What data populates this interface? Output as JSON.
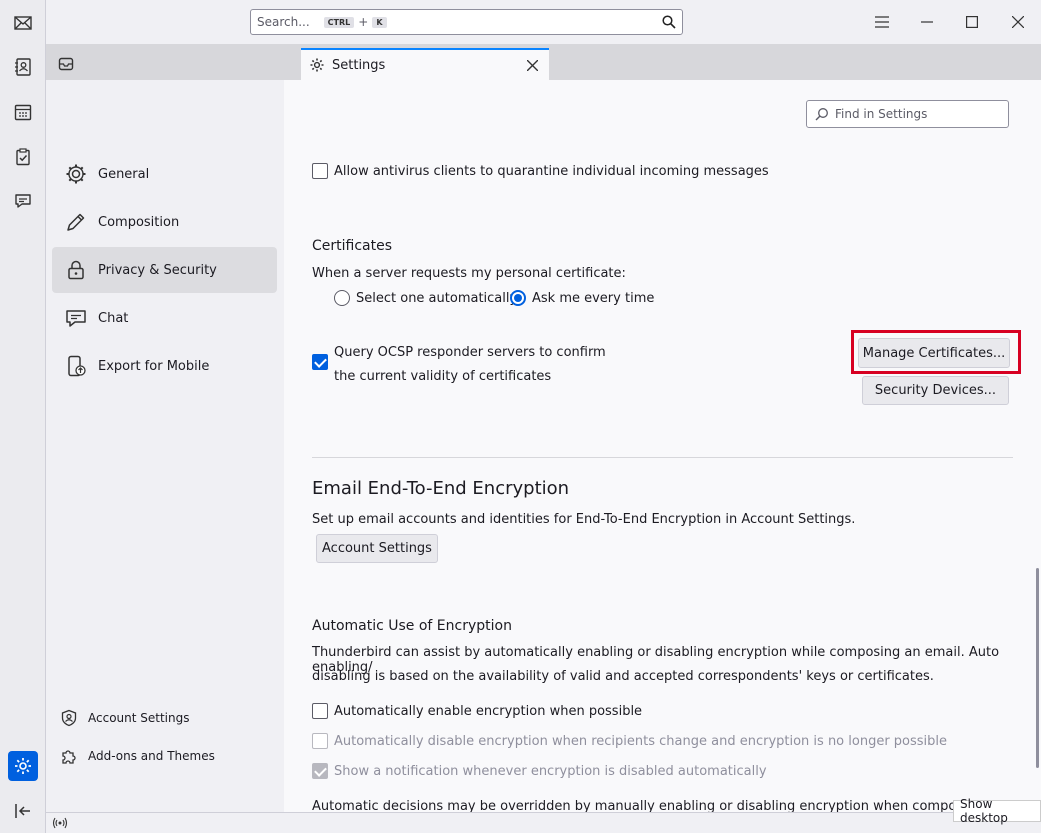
{
  "titlebar": {
    "search_placeholder": "Search...",
    "kbd_ctrl": "CTRL",
    "kbd_plus": "+",
    "kbd_k": "K"
  },
  "tab": {
    "label": "Settings"
  },
  "nav": {
    "items": [
      {
        "label": "General"
      },
      {
        "label": "Composition"
      },
      {
        "label": "Privacy & Security"
      },
      {
        "label": "Chat"
      },
      {
        "label": "Export for Mobile"
      }
    ],
    "footer": [
      {
        "label": "Account Settings"
      },
      {
        "label": "Add-ons and Themes"
      }
    ]
  },
  "content": {
    "find_placeholder": "Find in Settings",
    "antivirus_label": "Allow antivirus clients to quarantine individual incoming messages",
    "certificates": {
      "heading": "Certificates",
      "prompt": "When a server requests my personal certificate:",
      "option_auto": "Select one automatically",
      "option_ask": "Ask me every time",
      "ocsp_line1": "Query OCSP responder servers to confirm",
      "ocsp_line2": "the current validity of certificates",
      "manage_button": "Manage Certificates...",
      "devices_button": "Security Devices..."
    },
    "e2e": {
      "heading": "Email End-To-End Encryption",
      "description": "Set up email accounts and identities for End-To-End Encryption in Account Settings.",
      "button": "Account Settings"
    },
    "auto": {
      "heading": "Automatic Use of Encryption",
      "desc_line1": "Thunderbird can assist by automatically enabling or disabling encryption while composing an email. Auto enabling/",
      "desc_line2": "disabling is based on the availability of valid and accepted correspondents' keys or certificates.",
      "enable_label": "Automatically enable encryption when possible",
      "disable_label": "Automatically disable encryption when recipients change and encryption is no longer possible",
      "notify_label": "Show a notification whenever encryption is disabled automatically",
      "footer_text": "Automatic decisions may be overridden by manually enabling or disabling encryption when composing a mes"
    }
  },
  "taskbar": {
    "show_desktop": "Show desktop"
  },
  "colors": {
    "accent": "#0060df",
    "highlight_box": "#d70022"
  }
}
